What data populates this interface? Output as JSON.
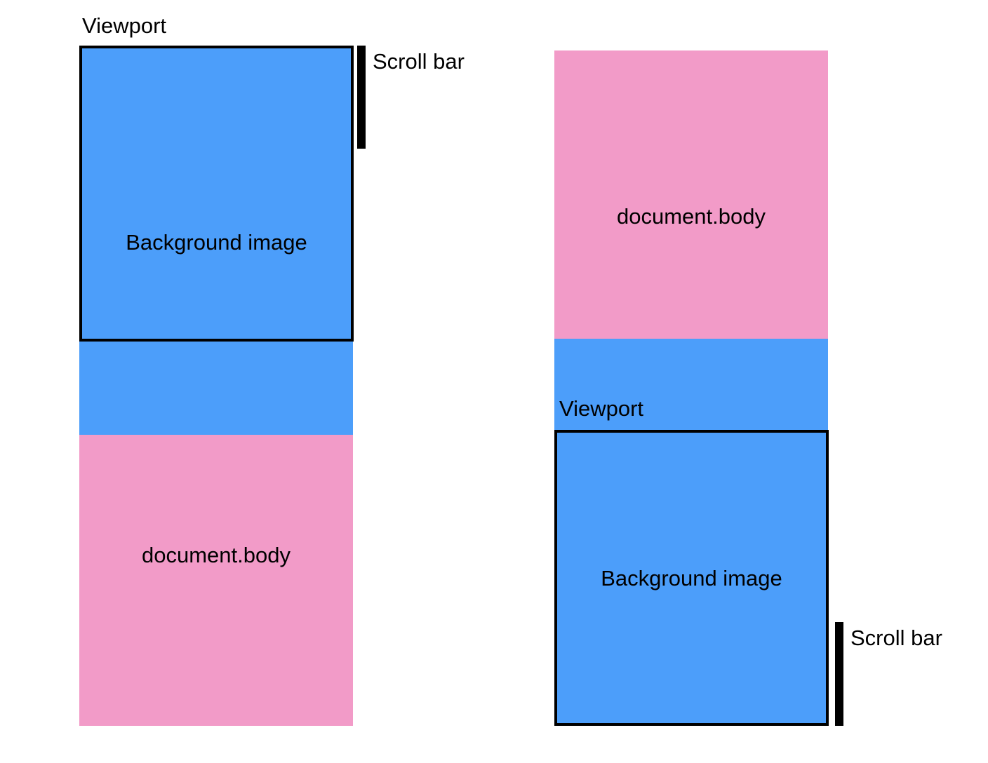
{
  "diagrams": [
    {
      "viewport_label": "Viewport",
      "background_label": "Background image",
      "body_label": "document.body",
      "scrollbar_label": "Scroll bar"
    },
    {
      "viewport_label": "Viewport",
      "background_label": "Background image",
      "body_label": "document.body",
      "scrollbar_label": "Scroll bar"
    }
  ],
  "colors": {
    "background_image": "#4c9efa",
    "document_body": "#f29bc8",
    "outline": "#000000"
  }
}
